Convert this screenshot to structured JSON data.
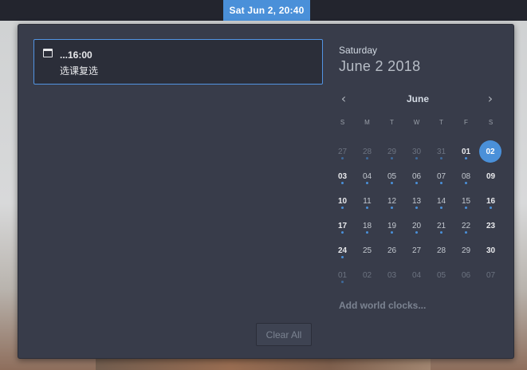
{
  "topbar": {
    "clock": "Sat Jun 2, 20:40"
  },
  "notification": {
    "icon": "calendar-icon",
    "title": "...16:00",
    "body": "选课复选"
  },
  "clear_all_label": "Clear All",
  "calendar": {
    "day_name": "Saturday",
    "full_date": "June  2 2018",
    "month": "June",
    "weekdays": [
      "S",
      "M",
      "T",
      "W",
      "T",
      "F",
      "S"
    ],
    "weeks": [
      [
        {
          "d": "27",
          "o": true,
          "e": true
        },
        {
          "d": "28",
          "o": true,
          "e": true
        },
        {
          "d": "29",
          "o": true,
          "e": true
        },
        {
          "d": "30",
          "o": true,
          "e": true
        },
        {
          "d": "31",
          "o": true,
          "e": true
        },
        {
          "d": "01",
          "o": false,
          "e": true
        },
        {
          "d": "02",
          "o": false,
          "e": false,
          "today": true
        }
      ],
      [
        {
          "d": "03",
          "o": false,
          "e": true
        },
        {
          "d": "04",
          "o": false,
          "e": true
        },
        {
          "d": "05",
          "o": false,
          "e": true
        },
        {
          "d": "06",
          "o": false,
          "e": true
        },
        {
          "d": "07",
          "o": false,
          "e": true
        },
        {
          "d": "08",
          "o": false,
          "e": true
        },
        {
          "d": "09",
          "o": false,
          "e": false
        }
      ],
      [
        {
          "d": "10",
          "o": false,
          "e": true
        },
        {
          "d": "11",
          "o": false,
          "e": true
        },
        {
          "d": "12",
          "o": false,
          "e": true
        },
        {
          "d": "13",
          "o": false,
          "e": true
        },
        {
          "d": "14",
          "o": false,
          "e": true
        },
        {
          "d": "15",
          "o": false,
          "e": true
        },
        {
          "d": "16",
          "o": false,
          "e": true
        }
      ],
      [
        {
          "d": "17",
          "o": false,
          "e": true
        },
        {
          "d": "18",
          "o": false,
          "e": true
        },
        {
          "d": "19",
          "o": false,
          "e": true
        },
        {
          "d": "20",
          "o": false,
          "e": true
        },
        {
          "d": "21",
          "o": false,
          "e": true
        },
        {
          "d": "22",
          "o": false,
          "e": true
        },
        {
          "d": "23",
          "o": false,
          "e": false
        }
      ],
      [
        {
          "d": "24",
          "o": false,
          "e": true
        },
        {
          "d": "25",
          "o": false,
          "e": false
        },
        {
          "d": "26",
          "o": false,
          "e": false
        },
        {
          "d": "27",
          "o": false,
          "e": false
        },
        {
          "d": "28",
          "o": false,
          "e": false
        },
        {
          "d": "29",
          "o": false,
          "e": false
        },
        {
          "d": "30",
          "o": false,
          "e": false
        }
      ],
      [
        {
          "d": "01",
          "o": true,
          "e": true
        },
        {
          "d": "02",
          "o": true,
          "e": false
        },
        {
          "d": "03",
          "o": true,
          "e": false
        },
        {
          "d": "04",
          "o": true,
          "e": false
        },
        {
          "d": "05",
          "o": true,
          "e": false
        },
        {
          "d": "06",
          "o": true,
          "e": false
        },
        {
          "d": "07",
          "o": true,
          "e": false
        }
      ]
    ]
  },
  "add_world_clocks": "Add world clocks...",
  "colors": {
    "accent": "#4a90d9",
    "panel": "#383c4a",
    "topbar": "#23252e"
  }
}
